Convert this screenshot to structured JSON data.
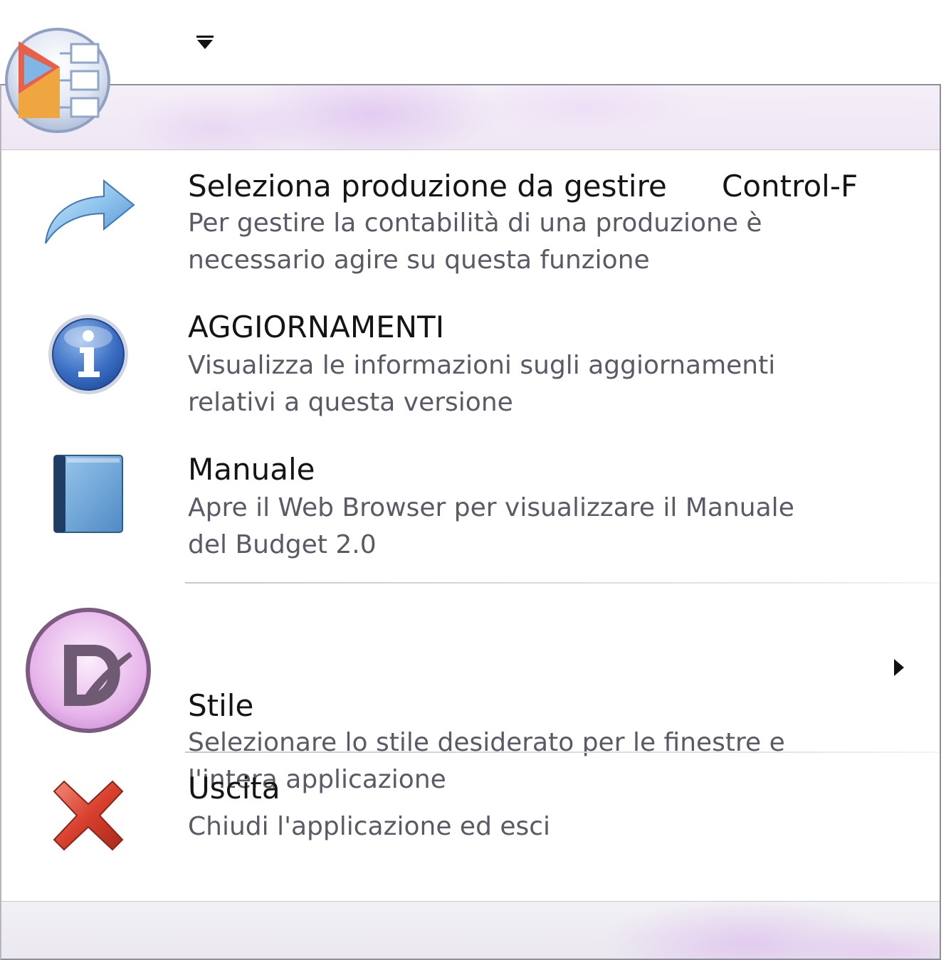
{
  "window": {
    "quick_access_dropdown_icon": "dropdown-arrow-icon",
    "app_button_icon": "application-orb-icon"
  },
  "colors": {
    "title_text": "#141414",
    "description_text": "#5a5a66",
    "accent_lilac": "#d6b0ec"
  },
  "menu": {
    "items": [
      {
        "title": "Seleziona produzione da gestire",
        "shortcut": "Control-F",
        "description_line1": "Per gestire la contabilità di una produzione è",
        "description_line2": "necessario agire su questa funzione",
        "icon": "forward-arrow-icon"
      },
      {
        "title": "AGGIORNAMENTI",
        "description_line1": "Visualizza le informazioni sugli aggiornamenti",
        "description_line2": "relativi a questa versione",
        "icon": "info-icon"
      },
      {
        "title": "Manuale",
        "description_line1": "Apre il Web Browser per visualizzare il Manuale",
        "description_line2": "del Budget 2.0",
        "icon": "book-icon"
      },
      {
        "title": "Stile",
        "description_line1": "Selezionare lo stile desiderato per le finestre e",
        "description_line2": "l'intera applicazione",
        "icon": "style-icon",
        "has_submenu": true
      },
      {
        "title": "Uscita",
        "description_line1": "Chiudi l'applicazione ed esci",
        "icon": "close-icon"
      }
    ]
  }
}
